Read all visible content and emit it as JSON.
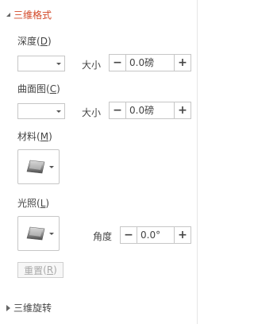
{
  "format3d": {
    "title": "三维格式",
    "depth": {
      "label": "深度",
      "key": "D",
      "size_label": "大小",
      "value": "0.0磅"
    },
    "contour": {
      "label": "曲面图",
      "key": "C",
      "size_label": "大小",
      "value": "0.0磅"
    },
    "material": {
      "label": "材料",
      "key": "M"
    },
    "lighting": {
      "label": "光照",
      "key": "L",
      "angle_label": "角度",
      "angle_value": "0.0°"
    },
    "reset": {
      "label": "重置",
      "key": "R"
    }
  },
  "rotation3d": {
    "title": "三维旋转"
  },
  "colors": {
    "accent": "#d24726",
    "disabled": "#a8a8a8",
    "border": "#c6c6c6"
  },
  "icons": {
    "expanded": "triangle-down-icon",
    "collapsed": "triangle-right-icon",
    "minus": "minus-icon",
    "plus": "plus-icon",
    "material": "bevel-shape-icon",
    "lighting": "bevel-shape-icon"
  }
}
